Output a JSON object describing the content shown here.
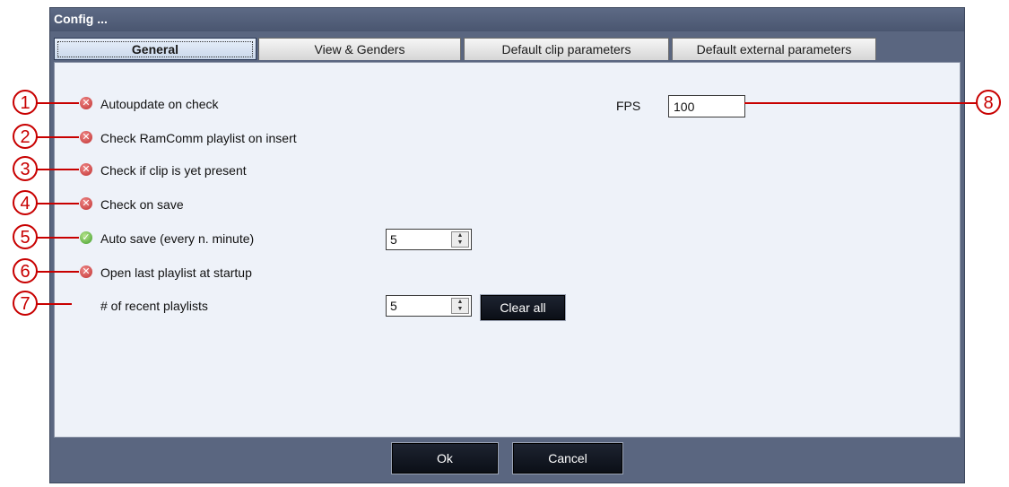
{
  "window": {
    "title": "Config ..."
  },
  "tabs": [
    {
      "label": "General",
      "active": true
    },
    {
      "label": "View & Genders"
    },
    {
      "label": "Default clip parameters"
    },
    {
      "label": "Default external parameters"
    }
  ],
  "options": [
    {
      "label": "Autoupdate on check",
      "state": "off",
      "icon": "x-circle-icon"
    },
    {
      "label": "Check RamComm playlist on insert",
      "state": "off",
      "icon": "x-circle-icon"
    },
    {
      "label": "Check if clip is yet present",
      "state": "off",
      "icon": "x-circle-icon"
    },
    {
      "label": "Check on save",
      "state": "off",
      "icon": "x-circle-icon"
    },
    {
      "label": "Auto save (every n. minute)",
      "state": "on",
      "icon": "check-circle-icon"
    },
    {
      "label": "Open last playlist at startup",
      "state": "off",
      "icon": "x-circle-icon"
    }
  ],
  "recent": {
    "label": "# of recent playlists",
    "value": "5",
    "clear_label": "Clear all"
  },
  "autosave": {
    "value": "5"
  },
  "fps": {
    "label": "FPS",
    "value": "100"
  },
  "footer": {
    "ok_label": "Ok",
    "cancel_label": "Cancel"
  },
  "callouts": [
    "1",
    "2",
    "3",
    "4",
    "5",
    "6",
    "7",
    "8"
  ],
  "colors": {
    "callout": "#c80000",
    "panel": "#eef2f9",
    "frame": "#5a6680"
  }
}
